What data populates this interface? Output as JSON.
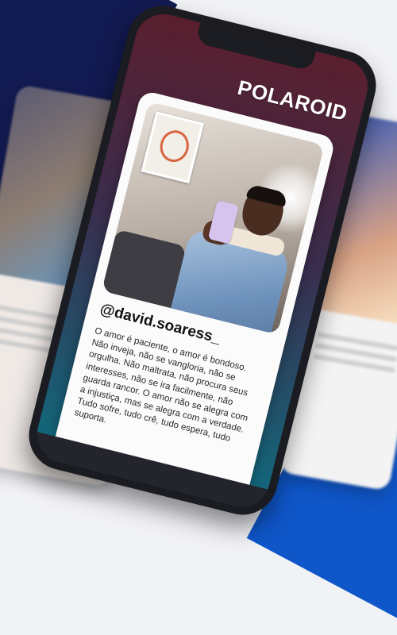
{
  "brand": {
    "label": "POLAROID"
  },
  "post": {
    "handle": "@david.soaress_",
    "caption": "O amor é paciente, o amor é bondoso. Não inveja, não se vangloria, não se orgulha. Não maltrata, não procura seus interesses, não se ira facilmente, não guarda rancor. O amor não se alegra com a injustiça, mas se alegra com a verdade. Tudo sofre, tudo crê, tudo espera, tudo suporta."
  },
  "colors": {
    "navy_stripe": "#121a52",
    "blue_stripe": "#0f56c9",
    "phone_frame": "#1b1c21",
    "screen_gradient_top": "#5a1f2e",
    "screen_gradient_bottom": "#0f6c7f"
  }
}
